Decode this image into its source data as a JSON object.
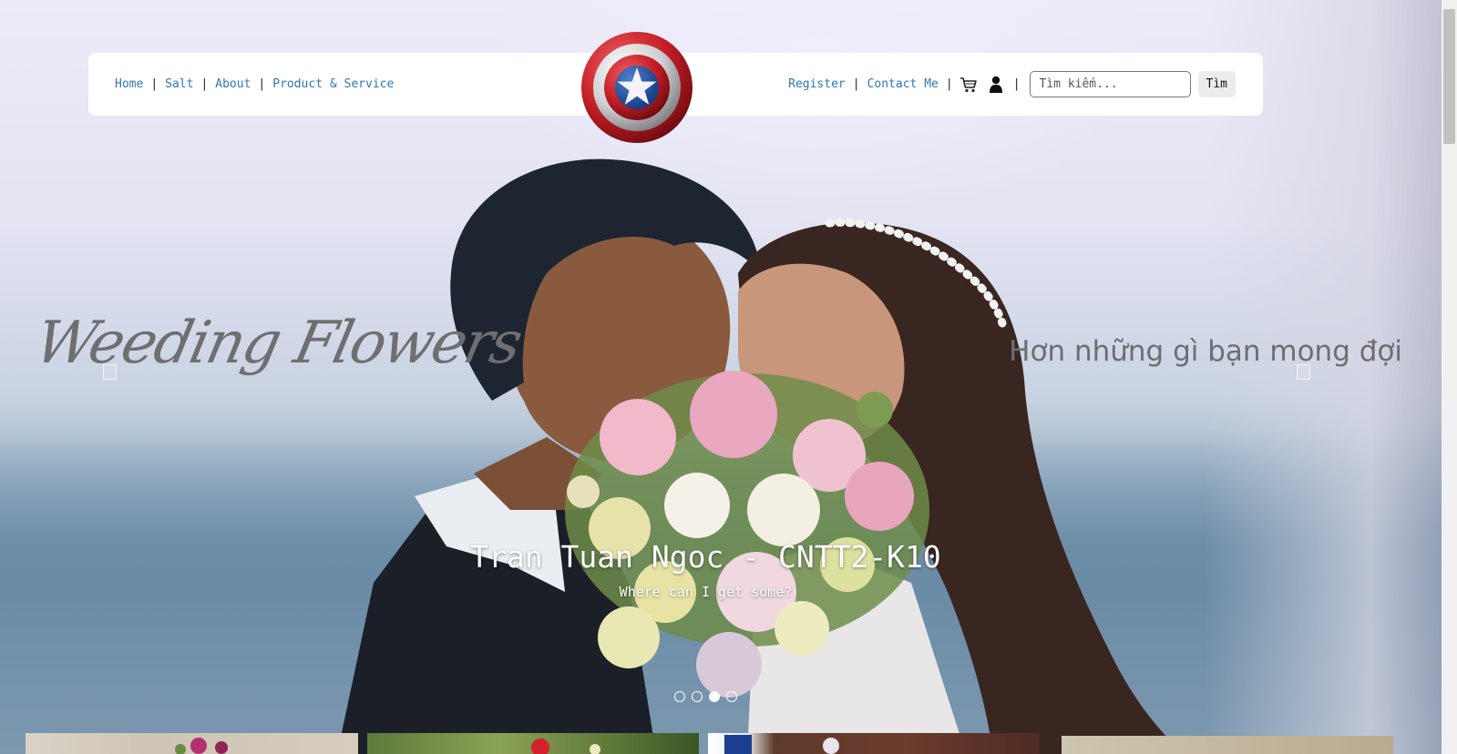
{
  "nav": {
    "left_links": [
      "Home",
      "Salt",
      "About",
      "Product & Service"
    ],
    "right_links": [
      "Register",
      "Contact Me"
    ],
    "separator": "|",
    "cart_icon": "cart-icon",
    "user_icon": "user-icon",
    "search": {
      "placeholder": "Tìm kiếm...",
      "value": ""
    },
    "search_button": "Tìm"
  },
  "logo": {
    "icon": "shield-star-logo",
    "colors": [
      "#c81e24",
      "#e0e0e0",
      "#1c4a9c"
    ]
  },
  "hero": {
    "script_title": "Weeding Flowers",
    "tagline": "Hơn những gì bạn mong đợi",
    "caption_title": "Tran Tuan Ngoc - CNTT2-K10",
    "caption_subtitle": "Where can I get some?",
    "slide_count": 4,
    "active_slide": 3
  },
  "colors": {
    "link": "#2e78b7",
    "caption_text": "#ffffff",
    "tagline": "#6e6e72"
  }
}
